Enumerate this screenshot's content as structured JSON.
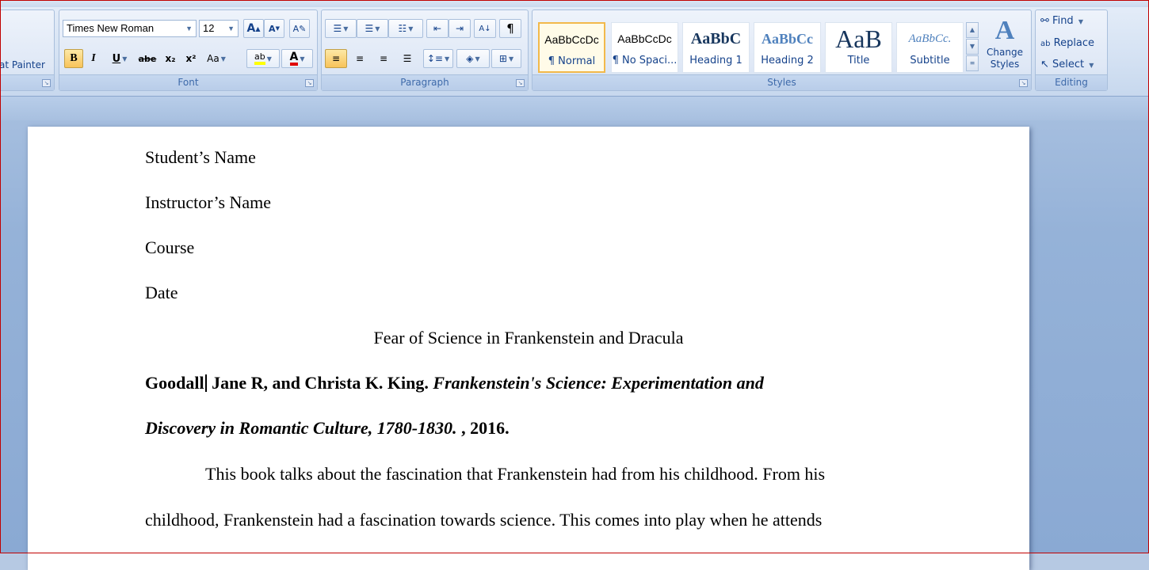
{
  "ribbon": {
    "clipboard": {
      "format_painter_label": "at Painter"
    },
    "font": {
      "label": "Font",
      "font_name": "Times New Roman",
      "font_size": "12",
      "bold": "B",
      "italic": "I",
      "underline": "U",
      "strikethrough": "abe",
      "subscript": "x₂",
      "superscript": "x²",
      "change_case": "Aa",
      "grow_font": "A",
      "shrink_font": "A",
      "highlight": "ab",
      "font_color": "A"
    },
    "paragraph": {
      "label": "Paragraph",
      "show_marks": "¶",
      "sort": "A↓"
    },
    "styles": {
      "label": "Styles",
      "change_styles_label": "Change Styles",
      "items": [
        {
          "sample": "AaBbCcDc",
          "name": "¶ Normal",
          "selected": true
        },
        {
          "sample": "AaBbCcDc",
          "name": "¶ No Spaci..."
        },
        {
          "sample": "AaBbC",
          "name": "Heading 1"
        },
        {
          "sample": "AaBbCc",
          "name": "Heading 2"
        },
        {
          "sample": "AaB",
          "name": "Title"
        },
        {
          "sample": "AaBbCc.",
          "name": "Subtitle"
        }
      ]
    },
    "editing": {
      "label": "Editing",
      "find_label": "Find",
      "replace_label": "Replace",
      "select_label": "Select"
    }
  },
  "document": {
    "student_name": "Student’s Name",
    "instructor_name": "Instructor’s Name",
    "course": "Course",
    "date": "Date",
    "title": "Fear of Science in Frankenstein and Dracula",
    "citation_author_a": "Goodall",
    "citation_author_b": " Jane R, and Christa K. King. ",
    "citation_title_1": "Frankenstein's Science: Experimentation and",
    "citation_title_2": "Discovery in Romantic Culture, 1780-1830.",
    "citation_year": " , 2016.",
    "body_line_1": "This book talks about the fascination that Frankenstein had from his childhood. From his",
    "body_line_2": "childhood, Frankenstein had a fascination towards science. This comes into play when he attends"
  },
  "colors": {
    "accent_border": "#c00000",
    "ribbon_text": "#15428b",
    "selected_style": "#f2b94b"
  }
}
